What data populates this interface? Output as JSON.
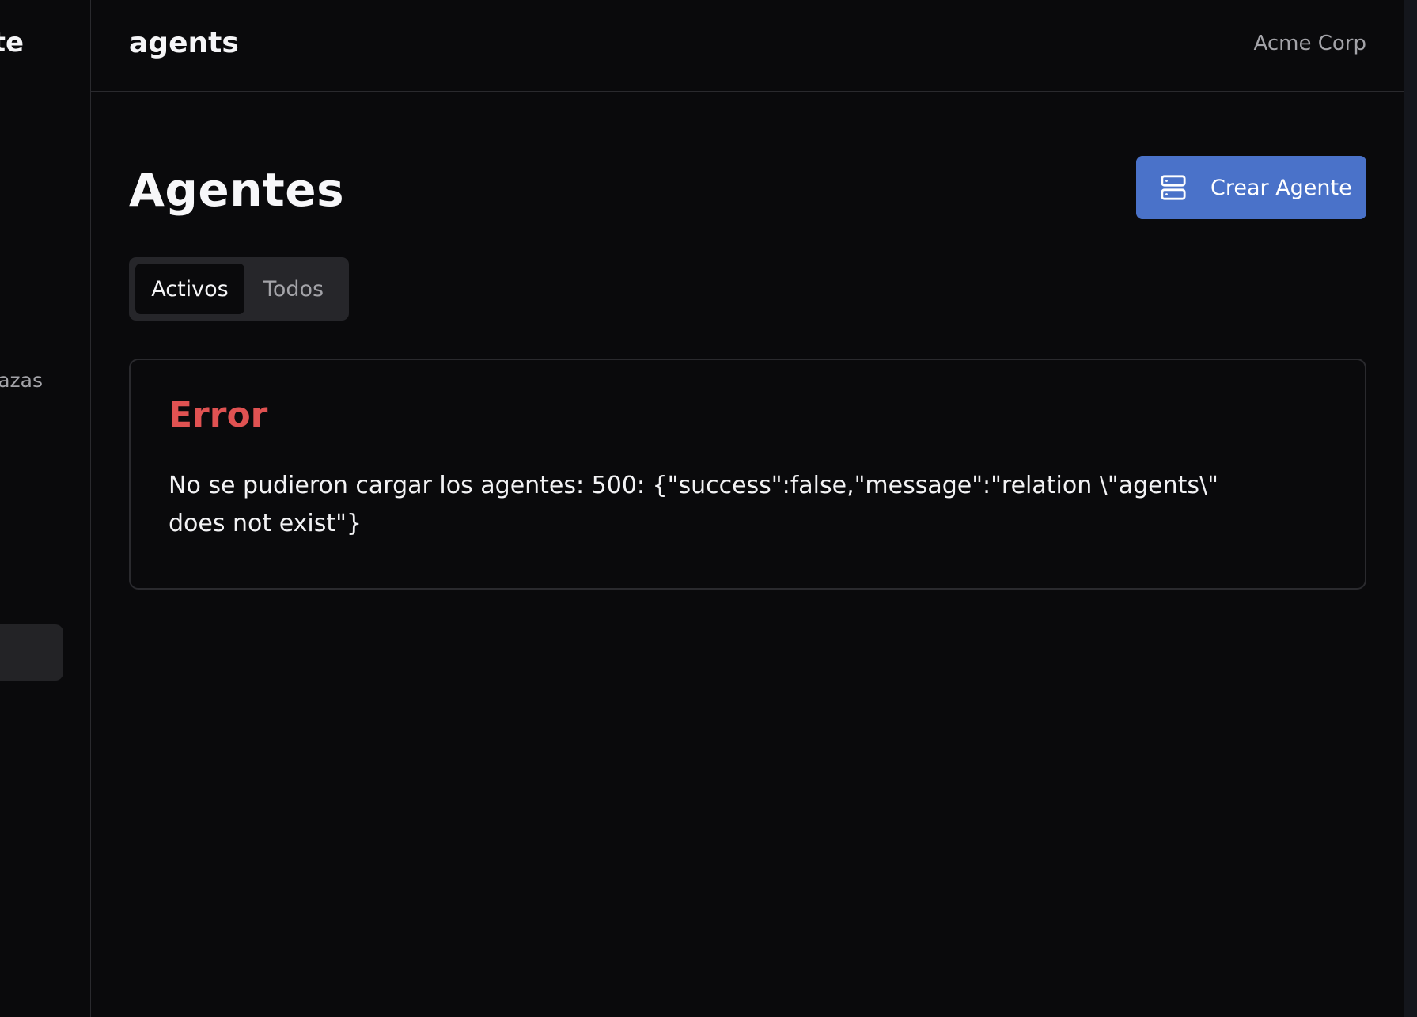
{
  "sidebar": {
    "brand_fragment": "te",
    "item_fragment": "azas"
  },
  "header": {
    "title": "agents",
    "organization": "Acme Corp"
  },
  "main": {
    "page_title": "Agentes",
    "create_button_label": "Crear Agente",
    "create_button_icon": "server-icon",
    "tabs": [
      {
        "label": "Activos",
        "active": true
      },
      {
        "label": "Todos",
        "active": false
      }
    ],
    "error": {
      "title": "Error",
      "message": "No se pudieron cargar los agentes: 500: {\"success\":false,\"message\":\"relation \\\"agents\\\" does not exist\"}"
    }
  },
  "colors": {
    "background": "#0a0a0c",
    "accent": "#4a72c9",
    "error": "#e05252",
    "muted_text": "#a3a3a8",
    "border": "#2a2a2e"
  }
}
